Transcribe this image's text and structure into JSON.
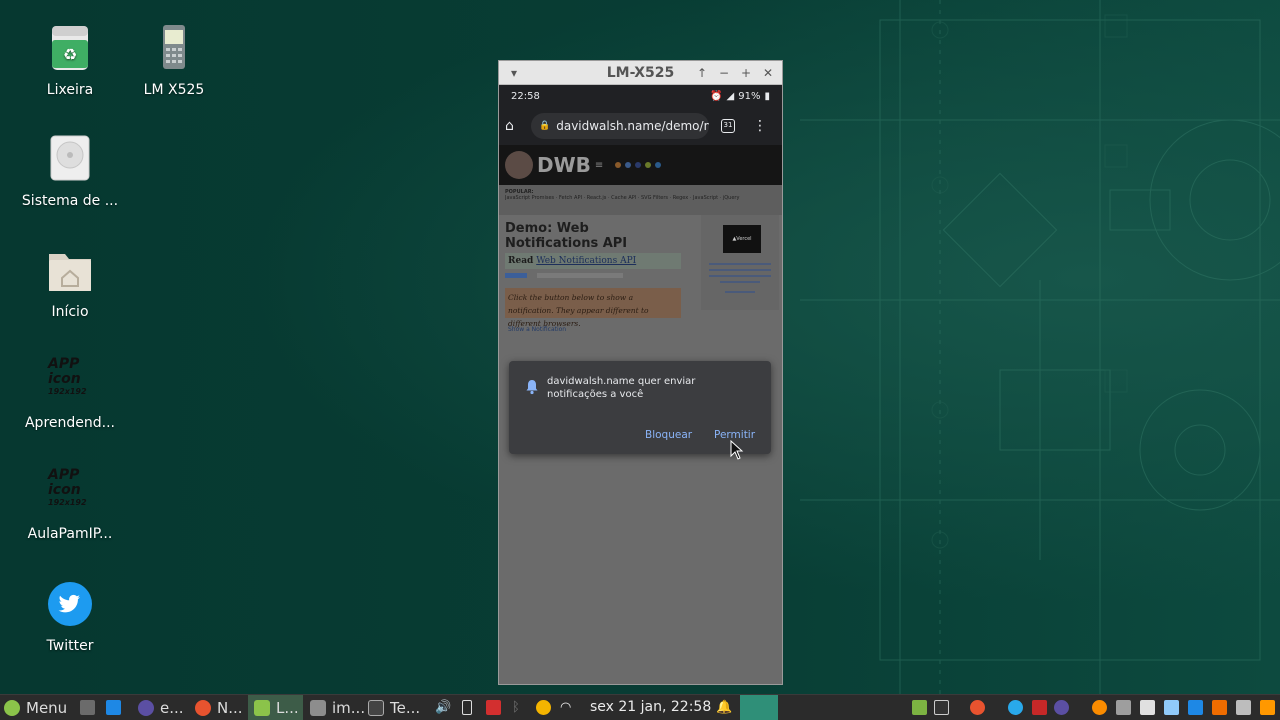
{
  "desktop": {
    "icons": [
      {
        "label": "Lixeira",
        "icon": "trash-icon"
      },
      {
        "label": "LM X525",
        "icon": "phone-icon"
      },
      {
        "label": "Sistema de ...",
        "icon": "disk-icon"
      },
      {
        "label": "Início",
        "icon": "home-folder-icon"
      },
      {
        "label": "Aprendend...",
        "icon": "app-icon"
      },
      {
        "label": "AulaPamIP...",
        "icon": "app-icon"
      },
      {
        "label": "Twitter",
        "icon": "twitter-icon"
      }
    ],
    "app_icon_text": {
      "line1": "APP",
      "line2": "icon",
      "line3": "192x192"
    }
  },
  "emulator": {
    "title": "LM-X525",
    "status": {
      "time": "22:58",
      "battery": "91%"
    },
    "browser": {
      "url": "davidwalsh.name/demo/not",
      "tabs_count": "31"
    },
    "page": {
      "logo": "DWB",
      "popular_label": "POPULAR:",
      "popular_links": "JavaScript Promises · Fetch API · React.js · Cache API · SVG Filters · Regex · JavaScript · jQuery",
      "demo_title": "Demo: Web Notifications API",
      "read_prefix": "Read",
      "read_link": "Web Notifications API",
      "note": "Click the button below to show a notification. They appear different to different browsers.",
      "show_link": "Show a Notification",
      "ad_logo": "▲Vercel"
    },
    "dialog": {
      "message": "davidwalsh.name quer enviar notificações a você",
      "block_label": "Bloquear",
      "allow_label": "Permitir"
    }
  },
  "taskbar": {
    "menu_label": "Menu",
    "windows": [
      {
        "label": "e...",
        "icon": "eclipse-icon"
      },
      {
        "label": "N...",
        "icon": "firefox-icon"
      },
      {
        "label": "L...",
        "icon": "android-icon"
      },
      {
        "label": "im...",
        "icon": "folder-icon"
      },
      {
        "label": "Te...",
        "icon": "terminal-icon"
      }
    ],
    "clock": "sex 21 jan, 22:58"
  },
  "colors": {
    "desktop_bg": "#0b3b32",
    "taskbar_bg": "#2b2b2b",
    "dialog_bg": "#3c3d40",
    "link_blue": "#8ab4f8"
  }
}
